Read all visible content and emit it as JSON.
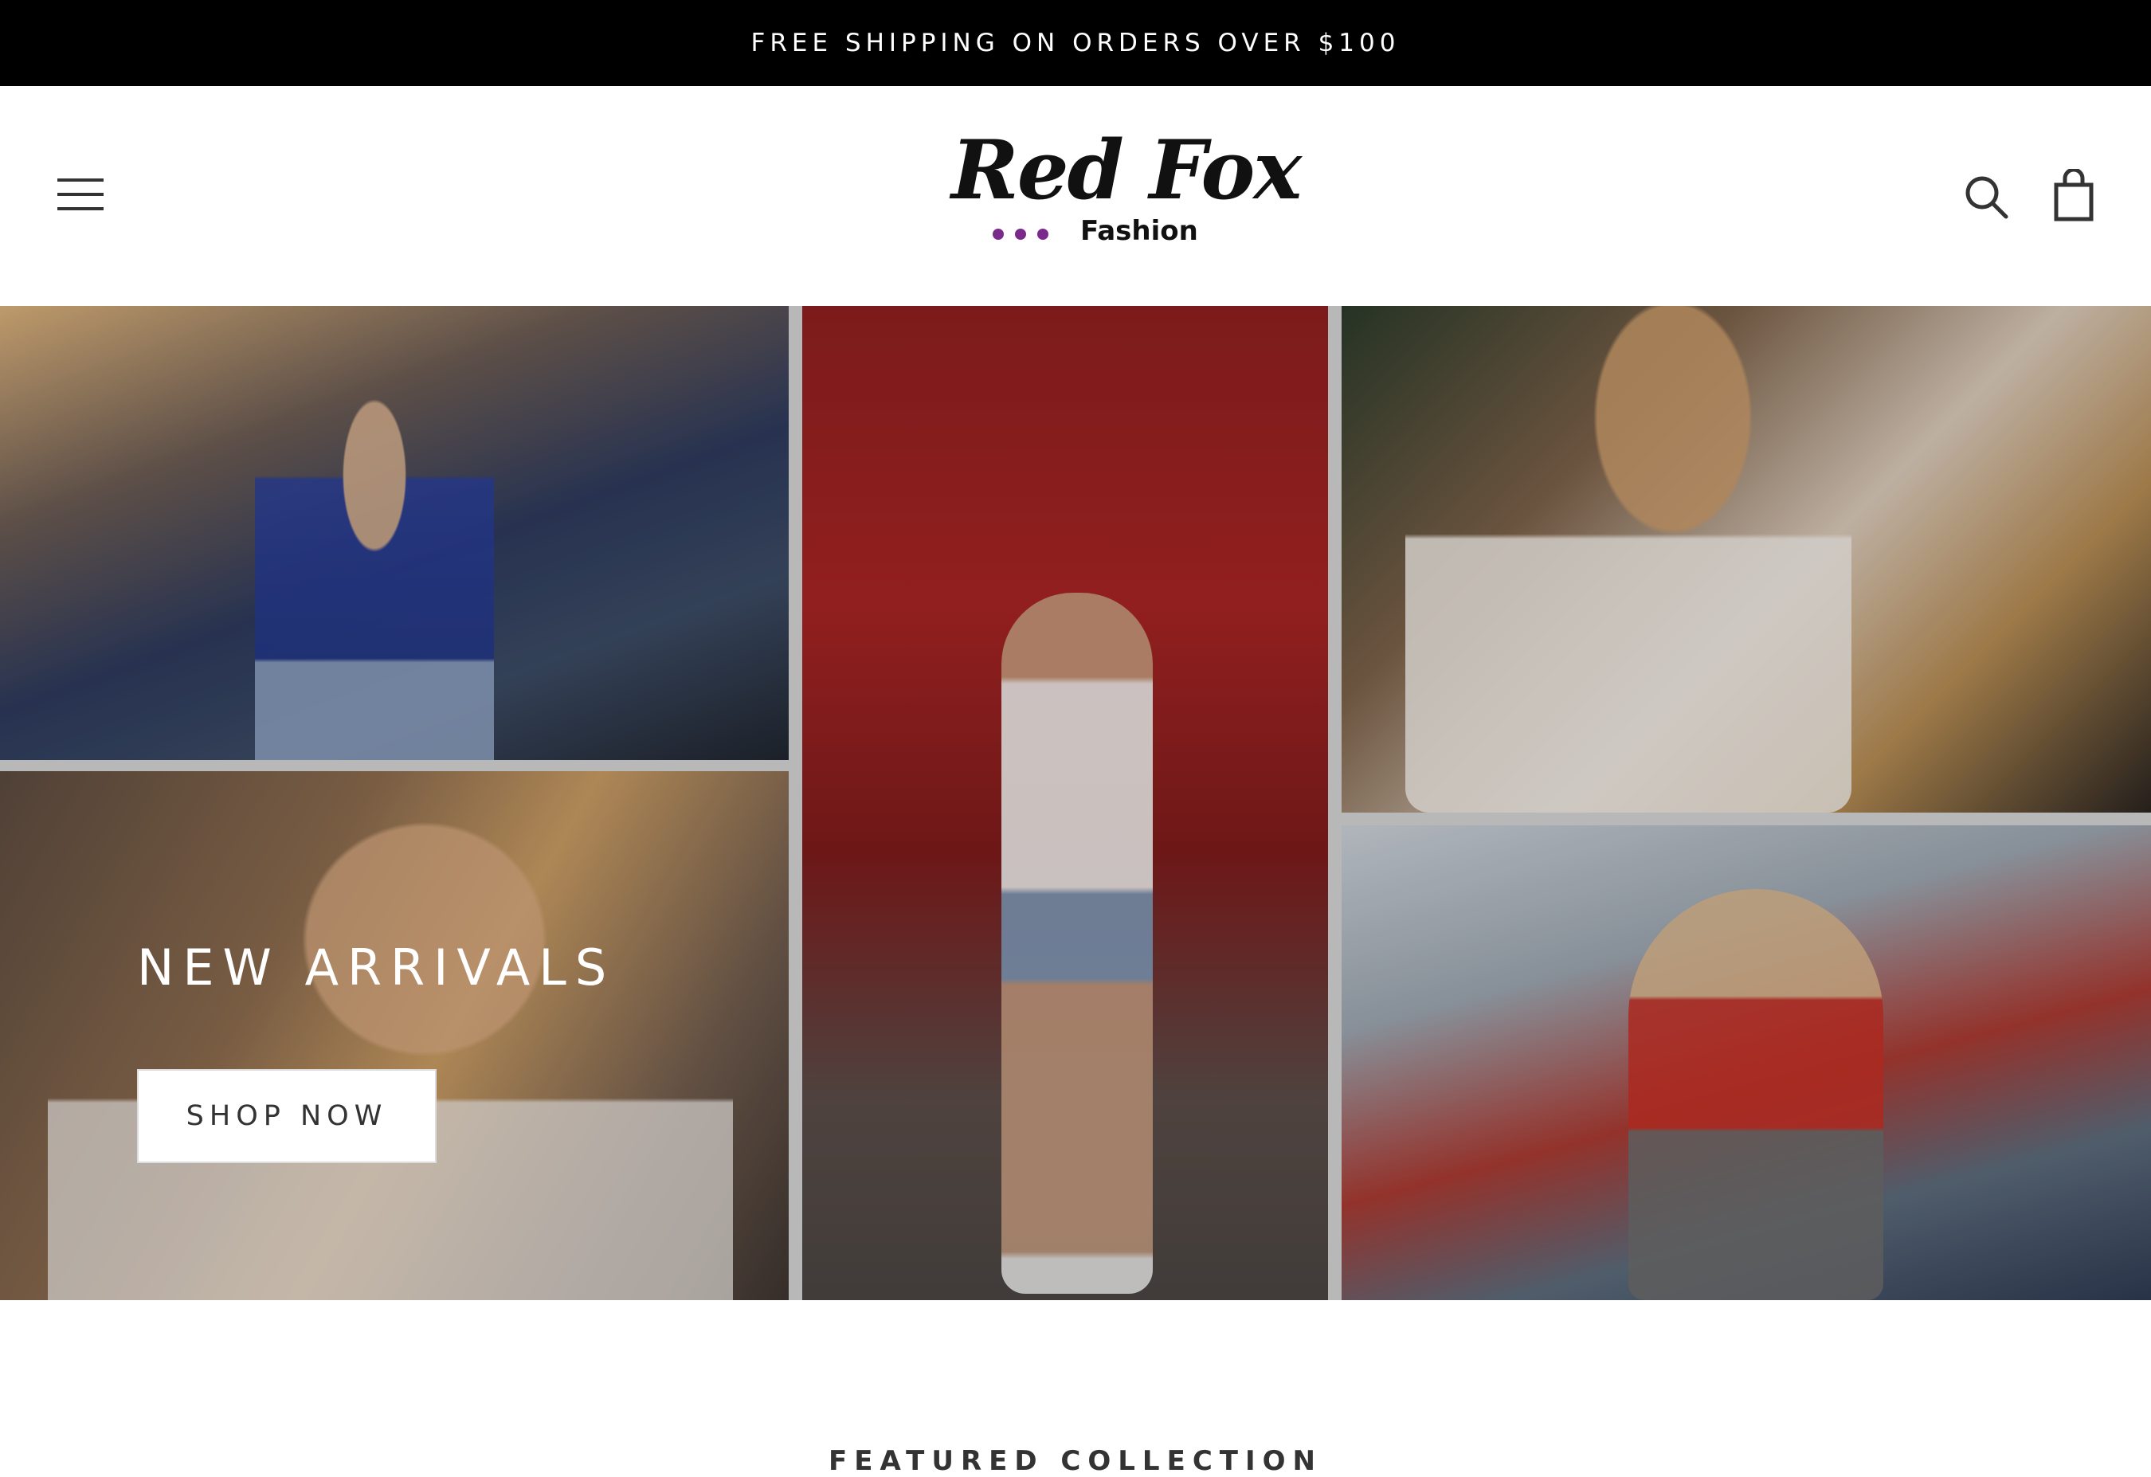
{
  "announcement": {
    "text": "FREE SHIPPING ON ORDERS OVER $100"
  },
  "header": {
    "menu_icon": "hamburger-icon",
    "logo": {
      "script": "Red Fox",
      "sub": "Fashion",
      "dot_color": "#7a2a8a"
    },
    "search_icon": "search-icon",
    "cart_icon": "shopping-bag-icon"
  },
  "hero": {
    "heading": "NEW ARRIVALS",
    "button_label": "SHOP NOW"
  },
  "featured": {
    "heading": "FEATURED COLLECTION"
  },
  "colors": {
    "announcement_bg": "#000000",
    "text_dark": "#333333",
    "logo_dot": "#7a2a8a"
  }
}
